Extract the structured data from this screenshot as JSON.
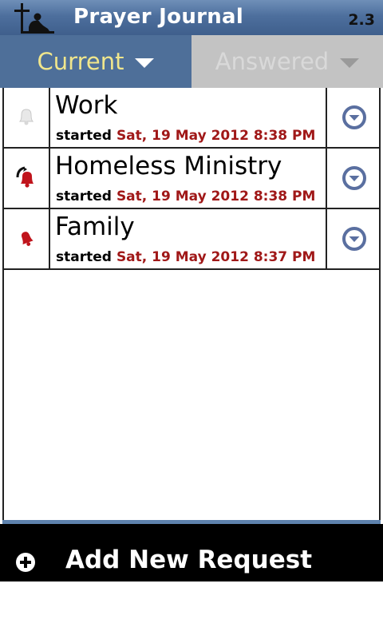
{
  "header": {
    "title": "Prayer Journal",
    "version": "2.3",
    "icon": "praying-at-cross-icon"
  },
  "tabs": [
    {
      "label": "Current",
      "active": true
    },
    {
      "label": "Answered",
      "active": false
    }
  ],
  "requests": [
    {
      "title": "Work",
      "started_label": "started",
      "date": "Sat, 19 May 2012 8:38 PM",
      "icon": "bell-faded-icon"
    },
    {
      "title": "Homeless Ministry",
      "started_label": "started",
      "date": "Sat, 19 May 2012 8:38 PM",
      "icon": "bell-ringing-icon"
    },
    {
      "title": "Family",
      "started_label": "started",
      "date": "Sat, 19 May 2012 8:37 PM",
      "icon": "bell-red-icon"
    }
  ],
  "footer": {
    "add_label": "Add New Request",
    "icon": "plus-circle-icon"
  },
  "colors": {
    "header_blue": "#4d6f9d",
    "active_tab_text": "#f0e68c",
    "date_red": "#a01818",
    "expand_icon": "#5a6fa0"
  }
}
